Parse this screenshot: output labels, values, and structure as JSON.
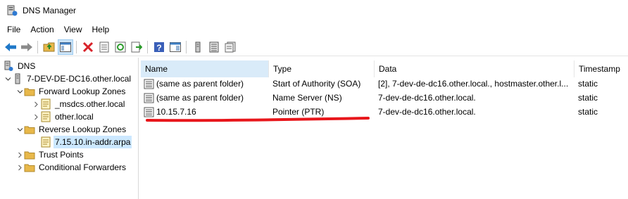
{
  "window": {
    "title": "DNS Manager"
  },
  "menu": [
    {
      "label": "File"
    },
    {
      "label": "Action"
    },
    {
      "label": "View"
    },
    {
      "label": "Help"
    }
  ],
  "tree": {
    "root": "DNS",
    "server": "7-DEV-DE-DC16.other.local",
    "forward_zones": "Forward Lookup Zones",
    "forward_children": [
      "_msdcs.other.local",
      "other.local"
    ],
    "reverse_zones": "Reverse Lookup Zones",
    "reverse_children": [
      "7.15.10.in-addr.arpa"
    ],
    "trust_points": "Trust Points",
    "conditional_forwarders": "Conditional Forwarders"
  },
  "list": {
    "columns": [
      "Name",
      "Type",
      "Data",
      "Timestamp"
    ],
    "rows": [
      {
        "name": "(same as parent folder)",
        "type": "Start of Authority (SOA)",
        "data": "[2], 7-dev-de-dc16.other.local., hostmaster.other.l...",
        "timestamp": "static"
      },
      {
        "name": "(same as parent folder)",
        "type": "Name Server (NS)",
        "data": "7-dev-de-dc16.other.local.",
        "timestamp": "static"
      },
      {
        "name": "10.15.7.16",
        "type": "Pointer (PTR)",
        "data": "7-dev-de-dc16.other.local.",
        "timestamp": "static"
      }
    ]
  },
  "colors": {
    "selection": "#cce8ff",
    "annotation": "#e8161b",
    "folder": "#e8b84a"
  }
}
